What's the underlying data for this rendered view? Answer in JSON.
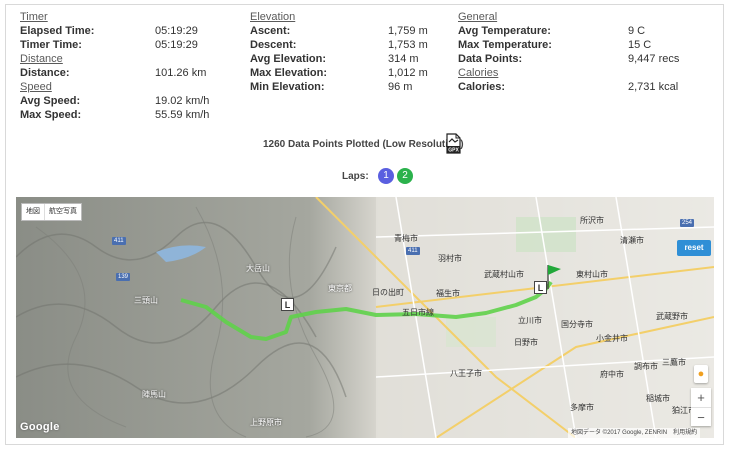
{
  "stats": {
    "timer": {
      "title": "Timer",
      "rows": [
        {
          "label": "Elapsed Time:",
          "value": "05:19:29"
        },
        {
          "label": "Timer Time:",
          "value": "05:19:29"
        }
      ]
    },
    "distance": {
      "title": "Distance",
      "rows": [
        {
          "label": "Distance:",
          "value": "101.26 km"
        }
      ]
    },
    "speed": {
      "title": "Speed",
      "rows": [
        {
          "label": "Avg Speed:",
          "value": "19.02 km/h"
        },
        {
          "label": "Max Speed:",
          "value": "55.59 km/h"
        }
      ]
    },
    "elevation": {
      "title": "Elevation",
      "rows": [
        {
          "label": "Ascent:",
          "value": "1,759 m"
        },
        {
          "label": "Descent:",
          "value": "1,753 m"
        },
        {
          "label": "Avg Elevation:",
          "value": "314 m"
        },
        {
          "label": "Max Elevation:",
          "value": "1,012 m"
        },
        {
          "label": "Min Elevation:",
          "value": "96 m"
        }
      ]
    },
    "general": {
      "title": "General",
      "rows": [
        {
          "label": "Avg Temperature:",
          "value": "9 C"
        },
        {
          "label": "Max Temperature:",
          "value": "15 C"
        },
        {
          "label": "Data Points:",
          "value": "9,447 recs"
        }
      ]
    },
    "calories": {
      "title": "Calories",
      "rows": [
        {
          "label": "Calories:",
          "value": "2,731 kcal"
        }
      ]
    }
  },
  "plotted_text": "1260 Data Points Plotted (Low Resolution)",
  "gpx_icon": "gpx-file-icon",
  "laps": {
    "label": "Laps:",
    "items": [
      "1",
      "2"
    ],
    "colors": [
      "#5a5fe0",
      "#2bb24c"
    ]
  },
  "map": {
    "map_type_buttons": [
      "地図",
      "航空写真"
    ],
    "reset_label": "reset",
    "google_label": "Google",
    "copyright": "地図データ ©2017 Google, ZENRIN　利用規約",
    "marker_label": "L",
    "route_color": "#5fd24a",
    "labels": [
      "所沢市",
      "青梅市",
      "羽村市",
      "東村山市",
      "清瀬市",
      "武蔵村山市",
      "東京都",
      "福生市",
      "日の出町",
      "五日市線",
      "立川市",
      "国分寺市",
      "小金井市",
      "武蔵野市",
      "八王子市",
      "府中市",
      "調布市",
      "三鷹市",
      "多摩市",
      "稲城市",
      "狛江市",
      "日野市",
      "上野原市",
      "大岳山",
      "三頭山",
      "陣馬山"
    ],
    "road_numbers": [
      "411",
      "139",
      "411",
      "254"
    ]
  }
}
